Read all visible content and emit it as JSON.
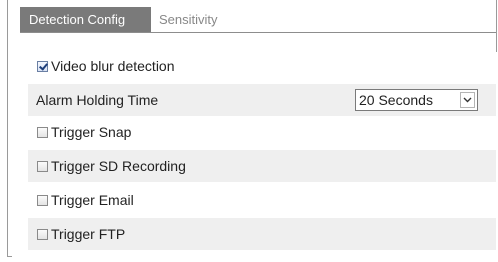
{
  "tabs": {
    "active": "Detection Config",
    "inactive": "Sensitivity"
  },
  "rows": {
    "video_blur": {
      "label": "Video blur detection",
      "checked": true
    },
    "alarm_holding": {
      "label": "Alarm Holding Time",
      "value": "20 Seconds"
    },
    "trigger_snap": {
      "label": "Trigger Snap",
      "checked": false
    },
    "trigger_sd": {
      "label": "Trigger SD Recording",
      "checked": false
    },
    "trigger_email": {
      "label": "Trigger Email",
      "checked": false
    },
    "trigger_ftp": {
      "label": "Trigger FTP",
      "checked": false
    }
  },
  "icons": {
    "dropdown": "chevron-down-icon",
    "checkbox": "checkbox-icon"
  },
  "colors": {
    "active_tab": "#7a7a7a",
    "row_shade": "#efefef"
  }
}
